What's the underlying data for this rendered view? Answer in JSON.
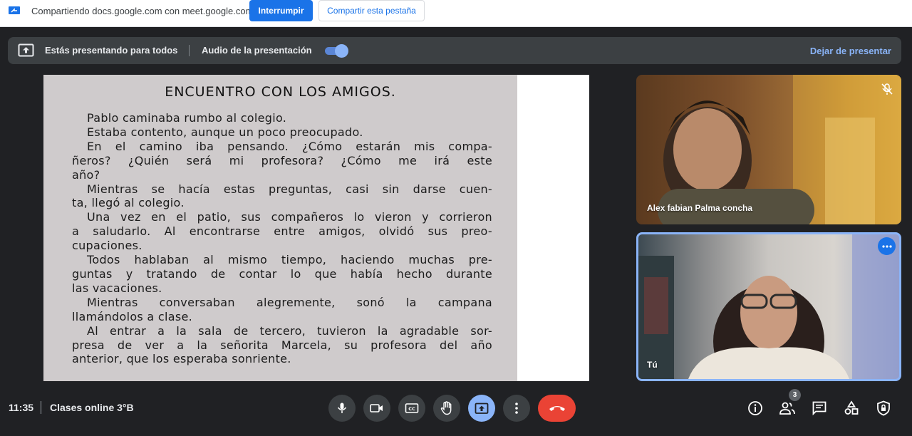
{
  "infobar": {
    "sharing_text": "Compartiendo docs.google.com con meet.google.com",
    "stop_label": "Interrumpir",
    "share_tab_label": "Compartir esta pestaña"
  },
  "present_bar": {
    "label": "Estás presentando para todos",
    "audio_label": "Audio de la presentación",
    "audio_enabled": true,
    "stop_label": "Dejar de presentar"
  },
  "slide": {
    "title": "ENCUENTRO CON LOS AMIGOS.",
    "lines": [
      "Pablo caminaba rumbo al colegio.",
      "Estaba contento, aunque un poco preocupado.",
      "En el camino iba pensando. ¿Cómo estarán mis compa-",
      "ñeros? ¿Quién será mi profesora? ¿Cómo me irá este",
      "año?",
      "Mientras se hacía estas preguntas, casi sin darse cuen-",
      "ta, llegó al colegio.",
      "Una vez en el patio, sus compañeros lo vieron y corrieron",
      "a saludarlo. Al encontrarse entre amigos, olvidó sus preo-",
      "cupaciones.",
      "Todos hablaban al mismo tiempo, haciendo muchas pre-",
      "guntas y tratando de contar lo que había hecho durante",
      "las vacaciones.",
      "Mientras conversaban alegremente, sonó la campana",
      "llamándolos a clase.",
      "Al entrar a la sala de tercero, tuvieron la agradable sor-",
      "presa de ver a la señorita Marcela, su profesora del año",
      "anterior, que los esperaba sonriente."
    ]
  },
  "participants": [
    {
      "name": "Alex fabian Palma concha",
      "muted": true
    },
    {
      "name": "Tú"
    }
  ],
  "bottom_bar": {
    "time": "11:35",
    "meeting_name": "Clases online 3°B",
    "participant_count": "3"
  },
  "colors": {
    "accent": "#8ab4f8",
    "primary_blue": "#1a73e8",
    "hangup_red": "#ea4335",
    "control_bg": "#3c4043",
    "background": "#202124"
  }
}
